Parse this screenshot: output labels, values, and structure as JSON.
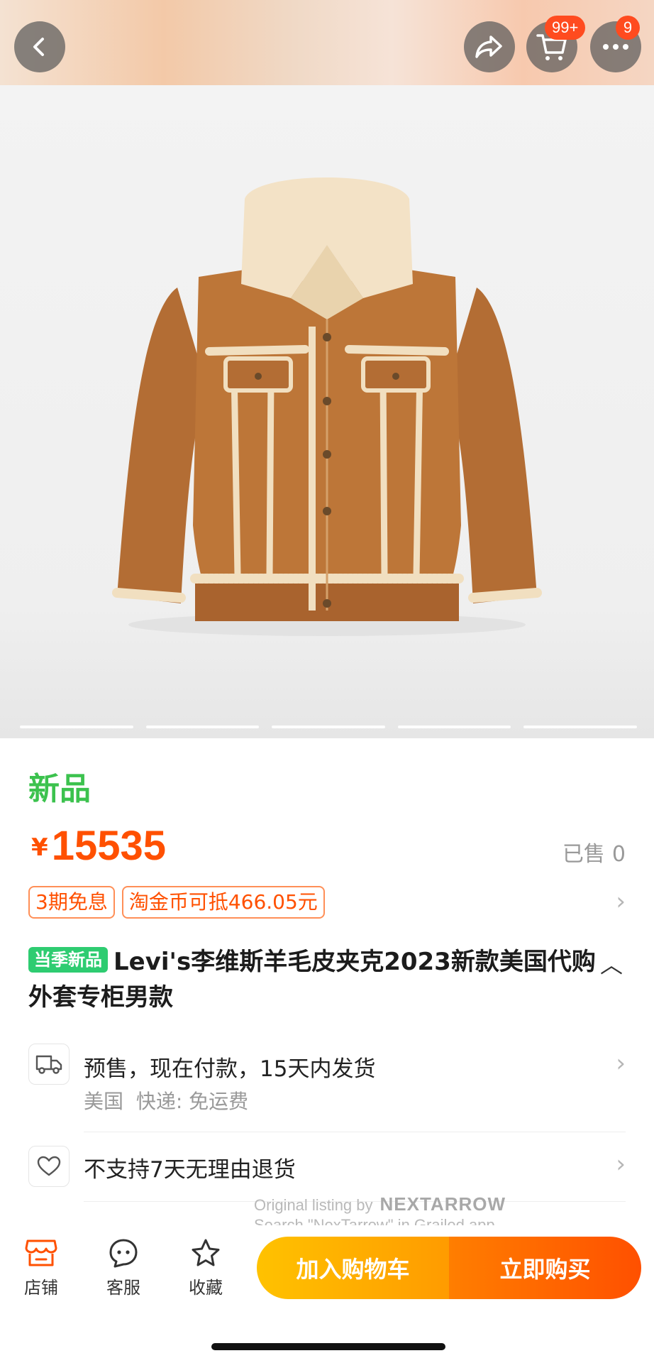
{
  "top_bar": {
    "cart_badge": "99+",
    "more_badge": "9"
  },
  "gallery": {
    "image_alt": "Levi's sherpa-lined suede trucker jacket",
    "page_indicator_count": 5
  },
  "product": {
    "new_tag": "新品",
    "currency_symbol": "¥",
    "price": "15535",
    "sold_label": "已售",
    "sold_count": "0",
    "coupons": [
      "3期免息",
      "淘金币可抵466.05元"
    ],
    "season_badge": "当季新品",
    "title": "Levi's李维斯羊毛皮夹克2023新款美国代购外套专柜男款"
  },
  "shipping": {
    "main": "预售，现在付款，15天内发货",
    "origin": "美国",
    "courier_label": "快递:",
    "fee": "免运费"
  },
  "returns": {
    "main": "不支持7天无理由退货"
  },
  "watermark": {
    "line1": "Original listing by",
    "brand": "NEXTARROW",
    "line2": "Search \"NexTarrow\" in Grailed app"
  },
  "bottom_bar": {
    "store_label": "店铺",
    "service_label": "客服",
    "favorite_label": "收藏",
    "add_to_cart_label": "加入购物车",
    "buy_now_label": "立即购买"
  },
  "colors": {
    "accent_orange": "#ff5000",
    "new_green": "#3cc24e",
    "cart_yellow": "#ffc200",
    "jacket_tan": "#b36d34",
    "sherpa_cream": "#f1dfc0"
  }
}
